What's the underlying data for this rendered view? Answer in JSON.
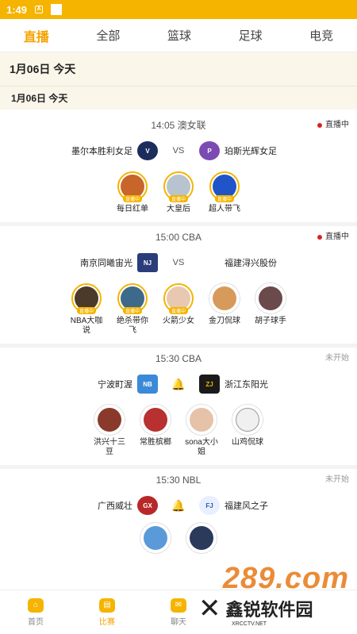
{
  "status_bar": {
    "time": "1:49",
    "notif_glyph": "A"
  },
  "tabs": [
    {
      "label": "直播",
      "active": true
    },
    {
      "label": "全部",
      "active": false
    },
    {
      "label": "篮球",
      "active": false
    },
    {
      "label": "足球",
      "active": false
    },
    {
      "label": "电竞",
      "active": false
    }
  ],
  "date_header": "1月06日  今天",
  "date_subheader": "1月06日  今天",
  "matches": [
    {
      "time_league": "14:05 澳女联",
      "status": "直播中",
      "home": "墨尔本胜利女足",
      "away": "珀斯光辉女足",
      "middle": "VS",
      "anchors": [
        {
          "name": "每日红单",
          "badge": "直播中"
        },
        {
          "name": "大皇后",
          "badge": "直播中"
        },
        {
          "name": "超人带飞",
          "badge": "直播中"
        }
      ]
    },
    {
      "time_league": "15:00 CBA",
      "status": "直播中",
      "home": "南京同曦宙光",
      "away": "福建浔兴股份",
      "middle": "VS",
      "anchors": [
        {
          "name": "NBA大咖说",
          "badge": "直播中"
        },
        {
          "name": "绝杀带你飞",
          "badge": "直播中"
        },
        {
          "name": "火箭少女",
          "badge": "直播中"
        },
        {
          "name": "金刀侃球",
          "badge": ""
        },
        {
          "name": "胡子球手",
          "badge": ""
        }
      ]
    },
    {
      "time_league": "15:30 CBA",
      "status": "未开始",
      "home": "宁波町渥",
      "away": "浙江东阳光",
      "middle": "🔔",
      "anchors": [
        {
          "name": "洪兴十三豆",
          "badge": ""
        },
        {
          "name": "常胜槟榔",
          "badge": ""
        },
        {
          "name": "sona大小姐",
          "badge": ""
        },
        {
          "name": "山鸡侃球",
          "badge": ""
        }
      ]
    },
    {
      "time_league": "15:30 NBL",
      "status": "未开始",
      "home": "广西威壮",
      "away": "福建风之子",
      "middle": "🔔"
    }
  ],
  "bottom_nav": [
    {
      "label": "首页"
    },
    {
      "label": "比赛"
    },
    {
      "label": "聊天"
    }
  ],
  "watermark": {
    "top": "289.com",
    "brand": "鑫锐软件园",
    "url": "XRCCTV.NET"
  },
  "colors": {
    "accent": "#f5b400",
    "live_dot": "#e02020",
    "date_bg": "#fbf6ea"
  }
}
